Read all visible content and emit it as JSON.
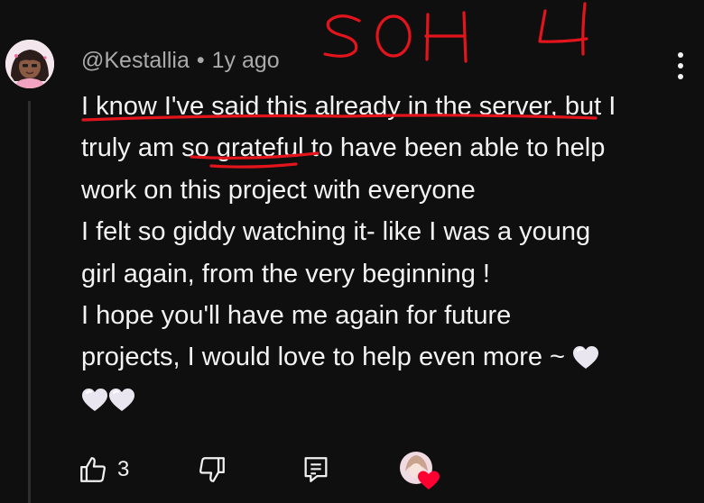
{
  "comment": {
    "author": "@Kestallia",
    "separator": "•",
    "timestamp": "1y ago",
    "body_lines": [
      "I know I've said this already in the server, but I",
      "truly am so grateful to have been able to help",
      "work on this project with everyone",
      "I felt so giddy watching it- like I was a young",
      "girl again, from the very beginning !",
      "I hope you'll have me again for future",
      "projects, I would love to help even more ~"
    ],
    "emoji": [
      "white-heart",
      "white-heart",
      "white-heart"
    ],
    "like_count": "3"
  },
  "annotation": {
    "handwritten_text": "SOH 4",
    "ink_color": "#e3141b"
  },
  "icons": {
    "like": "thumbs-up-icon",
    "dislike": "thumbs-down-icon",
    "reply": "reply-icon",
    "more": "more-vert-icon",
    "creator_heart": "creator-heart-icon"
  },
  "colors": {
    "background": "#0f0f0f",
    "text": "#f1f1f1",
    "meta": "#aaaaaa",
    "heart_red": "#ff0033"
  }
}
